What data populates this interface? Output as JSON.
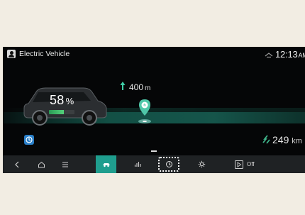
{
  "status_bar": {
    "title": "Electric Vehicle",
    "time": "12:13",
    "time_suffix": "AM"
  },
  "vehicle": {
    "battery_percent_value": "58",
    "battery_percent_sign": "%",
    "battery_level": 0.58
  },
  "navigation": {
    "distance_value": "400",
    "distance_unit": "m",
    "range_value": "249",
    "range_unit": "km"
  },
  "bottom_bar": {
    "off_label": "Off"
  },
  "colors": {
    "accent": "#1f9e8e",
    "battery": "#54d17b",
    "pin": "#4fc7a8",
    "range_icon": "#3fb58b"
  },
  "icons": [
    "profile-icon",
    "signal-icon",
    "arrow-up-icon",
    "charging-pin-icon",
    "drive-mode-icon",
    "range-icon",
    "back-icon",
    "home-icon",
    "menu-icon",
    "ev-icon",
    "stats-icon",
    "charge-schedule-icon",
    "settings-icon",
    "play-icon"
  ]
}
